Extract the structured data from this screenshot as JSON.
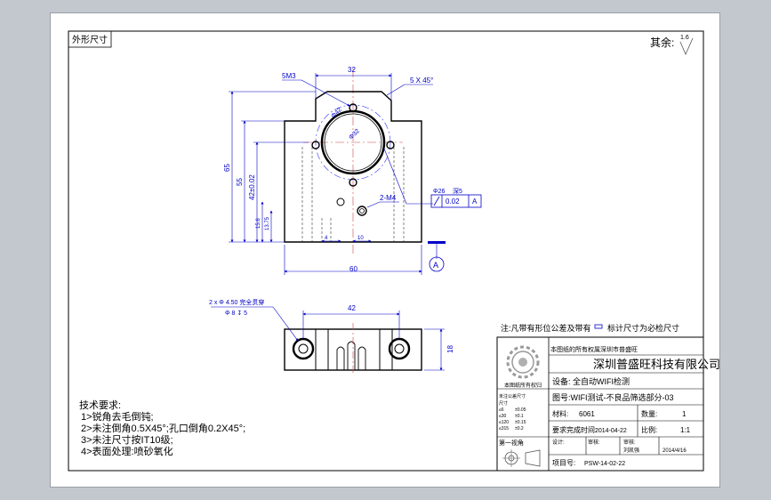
{
  "sheet": {
    "corner_label": "外形尺寸",
    "remaining_label": "其余:",
    "surface_mark": "1.6"
  },
  "front_view": {
    "dim_top_width": "32",
    "chamfer_note": "5 X 45°",
    "hole_top_note": "5M3",
    "bore_dia": "Φ32",
    "pitch_dia": "Φ42",
    "heights": [
      "65",
      "55",
      "42±0.02",
      "15.6",
      "13.75"
    ],
    "small_dims": [
      "4",
      "10",
      "2-M4"
    ],
    "base_width": "60",
    "gdt_dia": "Φ26",
    "gdt_depth": "深5",
    "gdt_tol": "0.02",
    "datum": "A"
  },
  "bottom_view": {
    "hole_callout": "2 x Φ 4.50 完全贯穿",
    "hole_callout_2": "Φ 8 ↧ 5",
    "width": "42",
    "height": "18"
  },
  "notes": {
    "heading": "技术要求:",
    "items": [
      "1>锐角去毛倒钝;",
      "2>未注倒角0.5X45°;孔口倒角0.2X45°;",
      "3>未注尺寸按IT10级;",
      "4>表面处理:喷砂氧化"
    ]
  },
  "title_block": {
    "note_line": "注:凡带有形位公差及带有",
    "note_line_2": "标计尺寸为必检尺寸",
    "garbled": "本图纸的所有权属深圳市普盛旺科技有限公司,未经许可不得复制或转让",
    "company": "深圳普盛旺科技有限公司",
    "device": "设备: 全自动WIFI检测",
    "drawing_no": "图号:WIFI测试-不良品筛选部分-03",
    "material_label": "材料:",
    "material": "6061",
    "qty_label": "数量:",
    "qty": "1",
    "date_label": "要求完成时间:",
    "date": "2014-04-22",
    "scale_label": "比例:",
    "scale": "1:1",
    "angle_label": "第一视角",
    "design_label": "设计:",
    "check_label": "审核:",
    "approve_label": "审核:",
    "sign_name": "刘凯强",
    "sign_date": "2014/4/16",
    "project_label": "项目号:",
    "project": "PSW-14-02-22",
    "tol_header": "未注公差尺寸",
    "tol_rows": [
      "尺寸",
      "≤6",
      "≤30",
      "≤120",
      "≤315"
    ],
    "tol_vals": [
      "±0.05",
      "±0.1",
      "±0.15",
      "±0.2"
    ]
  }
}
